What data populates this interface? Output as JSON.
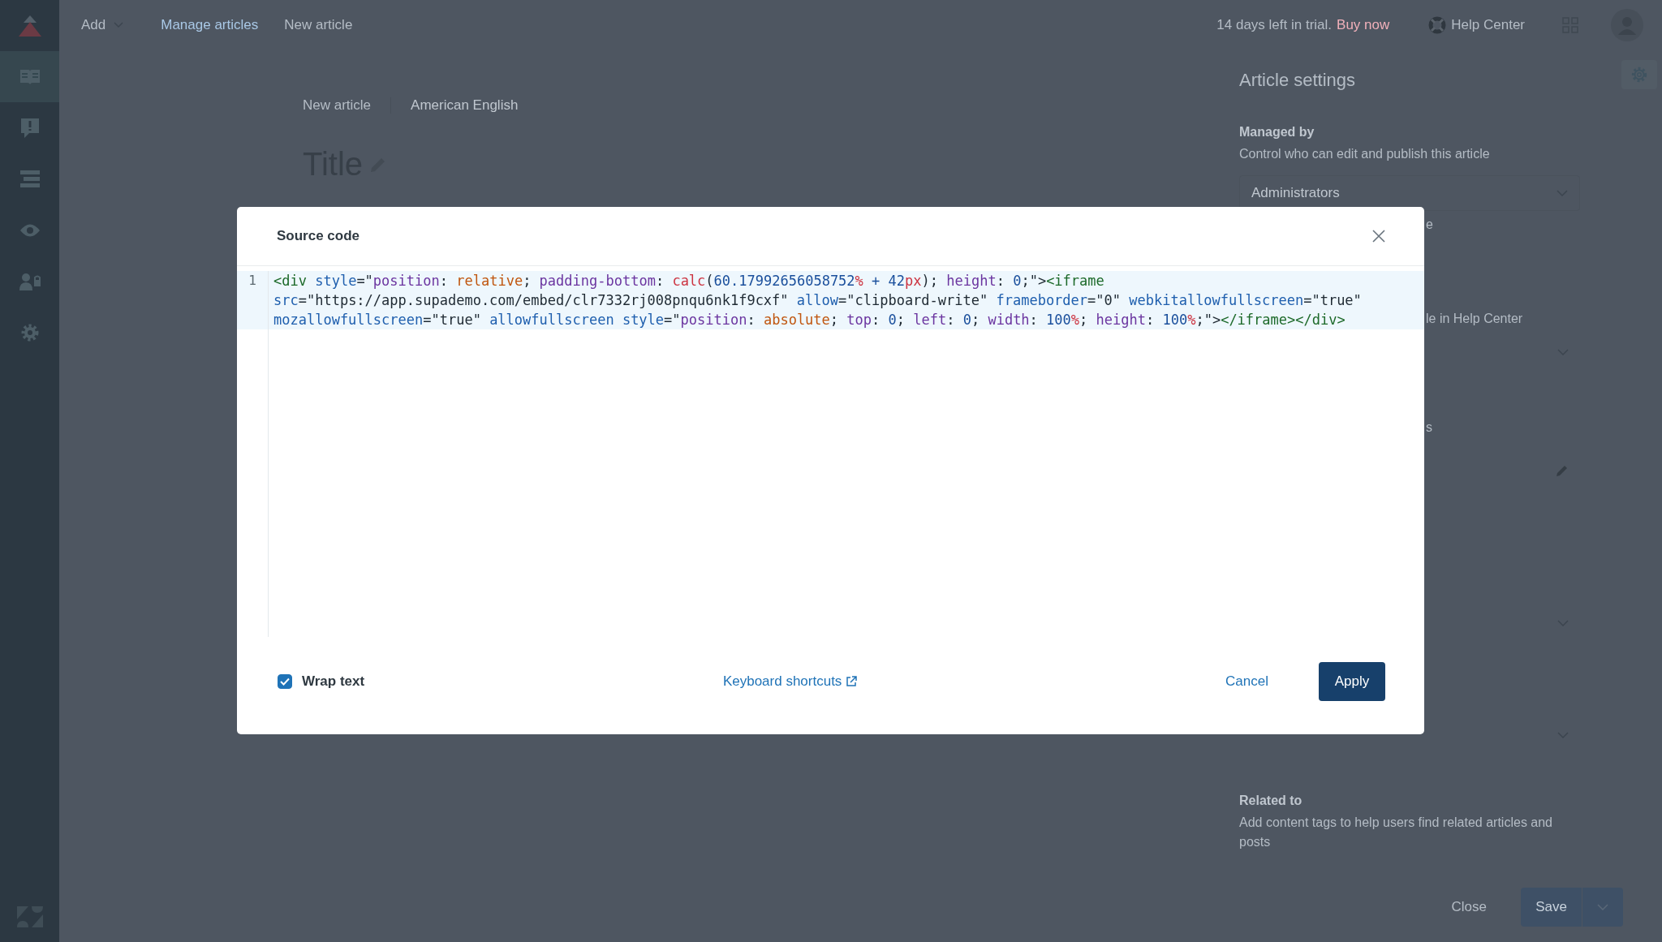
{
  "sidebar": {
    "items": [
      {
        "kind": "articles",
        "selected": true
      },
      {
        "kind": "alerts",
        "selected": false
      },
      {
        "kind": "list",
        "selected": false
      },
      {
        "kind": "preview",
        "selected": false
      },
      {
        "kind": "users",
        "selected": false
      },
      {
        "kind": "settings",
        "selected": false
      }
    ]
  },
  "top_bar": {
    "add_menu": "Add",
    "breadcrumb": [
      "Manage articles",
      "New article"
    ],
    "trial_notice": "14 days left in trial.",
    "buy_link": "Buy now",
    "help_center": "Help Center"
  },
  "editor": {
    "meta": [
      "New article",
      "American English"
    ],
    "title": "Title"
  },
  "settings_panel": {
    "title": "Article settings",
    "managed_by": {
      "label": "Managed by",
      "description": "Control who can edit and publish this article",
      "value": "Administrators"
    },
    "partly_hidden_texts": [
      "e",
      "le in Help Center",
      "s"
    ],
    "related_to": {
      "label": "Related to",
      "description": "Add content tags to help users find related articles and posts"
    },
    "close_button": "Close",
    "save_button": "Save"
  },
  "modal": {
    "title": "Source code",
    "code": {
      "line_number": "1",
      "rows": [
        {
          "tokens": [
            {
              "text": "<div ",
              "kind": "tag"
            },
            {
              "text": "style",
              "kind": "attr"
            },
            {
              "text": "=\"",
              "kind": "punct"
            },
            {
              "text": "position",
              "kind": "prop"
            },
            {
              "text": ": ",
              "kind": "punct"
            },
            {
              "text": "relative",
              "kind": "keyword"
            },
            {
              "text": "; ",
              "kind": "punct"
            },
            {
              "text": "padding-bottom",
              "kind": "prop"
            },
            {
              "text": ": ",
              "kind": "punct"
            },
            {
              "text": "calc",
              "kind": "func"
            },
            {
              "text": "(",
              "kind": "punct"
            },
            {
              "text": "60.17992656058752",
              "kind": "number"
            },
            {
              "text": "%",
              "kind": "unit"
            },
            {
              "text": " + ",
              "kind": "number"
            },
            {
              "text": "42",
              "kind": "number"
            },
            {
              "text": "px",
              "kind": "unit"
            },
            {
              "text": "); ",
              "kind": "punct"
            },
            {
              "text": "height",
              "kind": "prop"
            },
            {
              "text": ": ",
              "kind": "punct"
            },
            {
              "text": "0",
              "kind": "number"
            },
            {
              "text": ";\">",
              "kind": "punct"
            },
            {
              "text": "<iframe",
              "kind": "tag"
            }
          ]
        },
        {
          "tokens": [
            {
              "text": "src",
              "kind": "attr"
            },
            {
              "text": "=\"https://app.supademo.com/embed/clr7332rj008pnqu6nk1f9cxf\" ",
              "kind": "punct"
            },
            {
              "text": "allow",
              "kind": "attr"
            },
            {
              "text": "=\"clipboard-write\" ",
              "kind": "punct"
            },
            {
              "text": "frameborder",
              "kind": "attr"
            },
            {
              "text": "=\"0\" ",
              "kind": "punct"
            },
            {
              "text": "webkitallowfullscreen",
              "kind": "attr"
            },
            {
              "text": "=\"true\"",
              "kind": "punct"
            }
          ]
        },
        {
          "tokens": [
            {
              "text": "mozallowfullscreen",
              "kind": "attr"
            },
            {
              "text": "=\"true\" ",
              "kind": "punct"
            },
            {
              "text": "allowfullscreen ",
              "kind": "attr"
            },
            {
              "text": "style",
              "kind": "attr"
            },
            {
              "text": "=\"",
              "kind": "punct"
            },
            {
              "text": "position",
              "kind": "prop"
            },
            {
              "text": ": ",
              "kind": "punct"
            },
            {
              "text": "absolute",
              "kind": "keyword"
            },
            {
              "text": "; ",
              "kind": "punct"
            },
            {
              "text": "top",
              "kind": "prop"
            },
            {
              "text": ": ",
              "kind": "punct"
            },
            {
              "text": "0",
              "kind": "number"
            },
            {
              "text": "; ",
              "kind": "punct"
            },
            {
              "text": "left",
              "kind": "prop"
            },
            {
              "text": ": ",
              "kind": "punct"
            },
            {
              "text": "0",
              "kind": "number"
            },
            {
              "text": "; ",
              "kind": "punct"
            },
            {
              "text": "width",
              "kind": "prop"
            },
            {
              "text": ": ",
              "kind": "punct"
            },
            {
              "text": "100",
              "kind": "number"
            },
            {
              "text": "%",
              "kind": "unit"
            },
            {
              "text": "; ",
              "kind": "punct"
            },
            {
              "text": "height",
              "kind": "prop"
            },
            {
              "text": ": ",
              "kind": "punct"
            },
            {
              "text": "100",
              "kind": "number"
            },
            {
              "text": "%",
              "kind": "unit"
            },
            {
              "text": ";\">",
              "kind": "punct"
            },
            {
              "text": "</iframe></div>",
              "kind": "tag"
            }
          ]
        }
      ]
    },
    "wrap_text": {
      "label": "Wrap text",
      "checked": true
    },
    "shortcuts_link": "Keyboard shortcuts",
    "cancel_button": "Cancel",
    "apply_button": "Apply"
  }
}
